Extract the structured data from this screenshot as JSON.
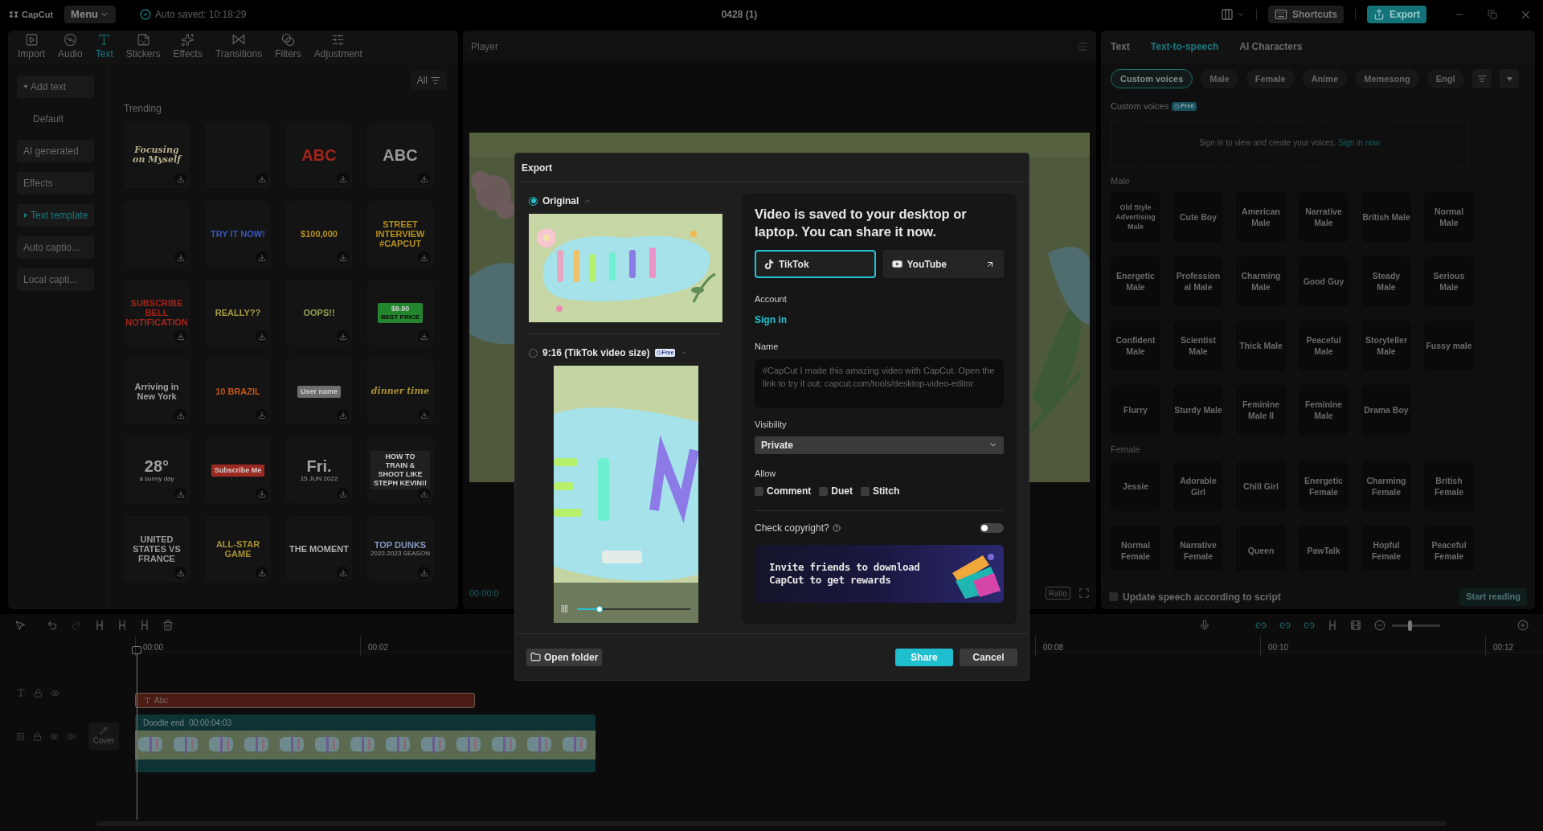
{
  "top_bar": {
    "app_name": "CapCut",
    "menu": "Menu",
    "autosave": "Auto saved: 10:18:29",
    "title": "0428 (1)",
    "shortcuts": "Shortcuts",
    "export": "Export"
  },
  "media_tabs": [
    {
      "label": "Import",
      "kind": "import",
      "selected": false
    },
    {
      "label": "Audio",
      "kind": "audio",
      "selected": false
    },
    {
      "label": "Text",
      "kind": "text",
      "selected": true
    },
    {
      "label": "Stickers",
      "kind": "stickers",
      "selected": false
    },
    {
      "label": "Effects",
      "kind": "effects",
      "selected": false
    },
    {
      "label": "Transitions",
      "kind": "transitions",
      "selected": false
    },
    {
      "label": "Filters",
      "kind": "filters",
      "selected": false
    },
    {
      "label": "Adjustment",
      "kind": "adjustment",
      "selected": false
    }
  ],
  "text_sidebar": [
    {
      "label": "Add text",
      "kind": "group",
      "expanded": true,
      "selected": false,
      "children": [
        {
          "label": "Default",
          "kind": "item",
          "selected": false
        }
      ]
    },
    {
      "label": "AI generated",
      "kind": "item",
      "selected": false
    },
    {
      "label": "Effects",
      "kind": "item",
      "selected": false
    },
    {
      "label": "Text template",
      "kind": "group",
      "expanded": false,
      "selected": true
    },
    {
      "label": "Auto captio...",
      "kind": "item",
      "selected": false
    },
    {
      "label": "Local capti...",
      "kind": "item",
      "selected": false
    }
  ],
  "filter": "All",
  "section": "Trending",
  "templates": [
    {
      "kind": "serif",
      "preview": "Focusing on Myself",
      "color": "#b5ad8a"
    },
    {
      "kind": "blank"
    },
    {
      "kind": "text",
      "preview": "ABC",
      "color": "#a3231b"
    },
    {
      "kind": "text",
      "preview": "ABC",
      "color": "#9a9a9a"
    },
    {
      "kind": "blank"
    },
    {
      "kind": "text",
      "preview": "TRY IT NOW!",
      "color": "#3a56b8"
    },
    {
      "kind": "text",
      "preview": "$100,000",
      "color": "#b58f1d"
    },
    {
      "kind": "text",
      "preview": "STREET INTERVIEW #CAPCUT",
      "color": "#b58f1d"
    },
    {
      "kind": "text",
      "preview": "SUBSCRIBE BELL NOTIFICATION",
      "color": "#a3231b"
    },
    {
      "kind": "text",
      "preview": "REALLY??",
      "color": "#a89c3c"
    },
    {
      "kind": "text",
      "preview": "OOPS!!",
      "color": "#98a04f"
    },
    {
      "kind": "badge",
      "preview": "$9.90",
      "caption": "BEST PRICE",
      "color": "#23862f"
    },
    {
      "kind": "text",
      "preview": "Arriving in New York",
      "color": "#a0a0a0"
    },
    {
      "kind": "text",
      "preview": "10 BRAZIL",
      "color": "#c2561a"
    },
    {
      "kind": "badge",
      "preview": "User name",
      "color": "#6e6e6e"
    },
    {
      "kind": "serif",
      "preview": "dinner time",
      "color": "#a89135"
    },
    {
      "kind": "text",
      "preview": "28°",
      "caption": "a sunny day",
      "color": "#a0a0a0"
    },
    {
      "kind": "badge",
      "preview": "Subscribe Me",
      "color": "#9c2a22"
    },
    {
      "kind": "text",
      "preview": "Fri.",
      "caption": "15 JUN 2022",
      "color": "#a0a0a0"
    },
    {
      "kind": "badge",
      "preview": "HOW TO TRAIN & SHOOT LIKE STEPH KEVIN!!",
      "color": "#202020"
    },
    {
      "kind": "text",
      "preview": "UNITED STATES VS FRANCE",
      "color": "#9a9a9a"
    },
    {
      "kind": "text",
      "preview": "ALL-STAR GAME",
      "color": "#a89135"
    },
    {
      "kind": "text",
      "preview": "THE MOMENT",
      "color": "#b0b0b0"
    },
    {
      "kind": "text",
      "preview": "TOP DUNKS",
      "caption": "2022-2023 SEASON",
      "color": "#8497bd"
    }
  ],
  "player": {
    "title": "Player",
    "time": "00:00:0",
    "ratio": "Ratio"
  },
  "right_panel": {
    "tabs": [
      {
        "label": "Text",
        "selected": false
      },
      {
        "label": "Text-to-speech",
        "selected": true
      },
      {
        "label": "AI Characters",
        "selected": false
      }
    ],
    "chips": [
      {
        "label": "Custom voices",
        "selected": true
      },
      {
        "label": "Male",
        "selected": false
      },
      {
        "label": "Female",
        "selected": false
      },
      {
        "label": "Anime",
        "selected": false
      },
      {
        "label": "Memesong",
        "selected": false
      },
      {
        "label": "Engl",
        "selected": false
      }
    ],
    "custom_voices": {
      "title": "Custom voices",
      "badge": "Free",
      "prompt": "Sign in to view and create your voices.",
      "link": "Sign in now"
    },
    "voice_groups": [
      {
        "title": "Male",
        "voices": [
          "Old Style Advertising Male",
          "Cute Boy",
          "American Male",
          "Narrative Male",
          "British Male",
          "Normal Male",
          "Energetic Male",
          "Professional Male",
          "Charming Male",
          "Good Guy",
          "Steady Male",
          "Serious Male",
          "Confident Male",
          "Scientist Male",
          "Thick Male",
          "Peaceful Male",
          "Storyteller Male",
          "Fussy male",
          "Flurry",
          "Sturdy Male",
          "Feminine Male II",
          "Feminine Male",
          "Drama Boy"
        ]
      },
      {
        "title": "Female",
        "voices": [
          "Jessie",
          "Adorable Girl",
          "Chill Girl",
          "Energetic Female",
          "Charming Female",
          "British Female",
          "Normal Female",
          "Narrative Female",
          "Queen",
          "PawTalk",
          "Hopful Female",
          "Peaceful Female"
        ]
      }
    ],
    "update_speech": {
      "label": "Update speech according to script",
      "checked": false
    },
    "start_reading": {
      "label": "Start reading",
      "disabled": true
    }
  },
  "timeline": {
    "ruler": [
      "00:00",
      "00:02",
      "00:08",
      "00:10",
      "00:12"
    ],
    "text_clip": "Abc",
    "video_clip": {
      "name": "Doodle end",
      "duration": "00:00:04:03"
    },
    "cover": "Cover"
  },
  "export_dialog": {
    "title": "Export",
    "formats": [
      {
        "label": "Original",
        "kind": "landscape",
        "selected": true
      },
      {
        "label": "9:16 (TikTok video size)",
        "kind": "portrait",
        "badge": "Free",
        "selected": false
      }
    ],
    "preview": {
      "level": 0.2
    },
    "message": "Video is saved to your desktop or laptop. You can share it now.",
    "platforms": [
      {
        "label": "TikTok",
        "kind": "tiktok",
        "selected": true
      },
      {
        "label": "YouTube",
        "kind": "youtube",
        "selected": false
      }
    ],
    "account_label": "Account",
    "sign_in": "Sign in",
    "name_label": "Name",
    "name_placeholder": "#CapCut I made this amazing video with CapCut. Open the link to try it out: capcut.com/tools/desktop-video-editor",
    "visibility_label": "Visibility",
    "visibility": "Private",
    "allow_label": "Allow",
    "allow": [
      {
        "label": "Comment",
        "checked": false
      },
      {
        "label": "Duet",
        "checked": false
      },
      {
        "label": "Stitch",
        "checked": false
      }
    ],
    "copyright": {
      "label": "Check copyright?",
      "on": false
    },
    "banner": "Invite friends to download CapCut to get rewards",
    "open_folder": "Open folder",
    "share": "Share",
    "cancel": "Cancel"
  }
}
